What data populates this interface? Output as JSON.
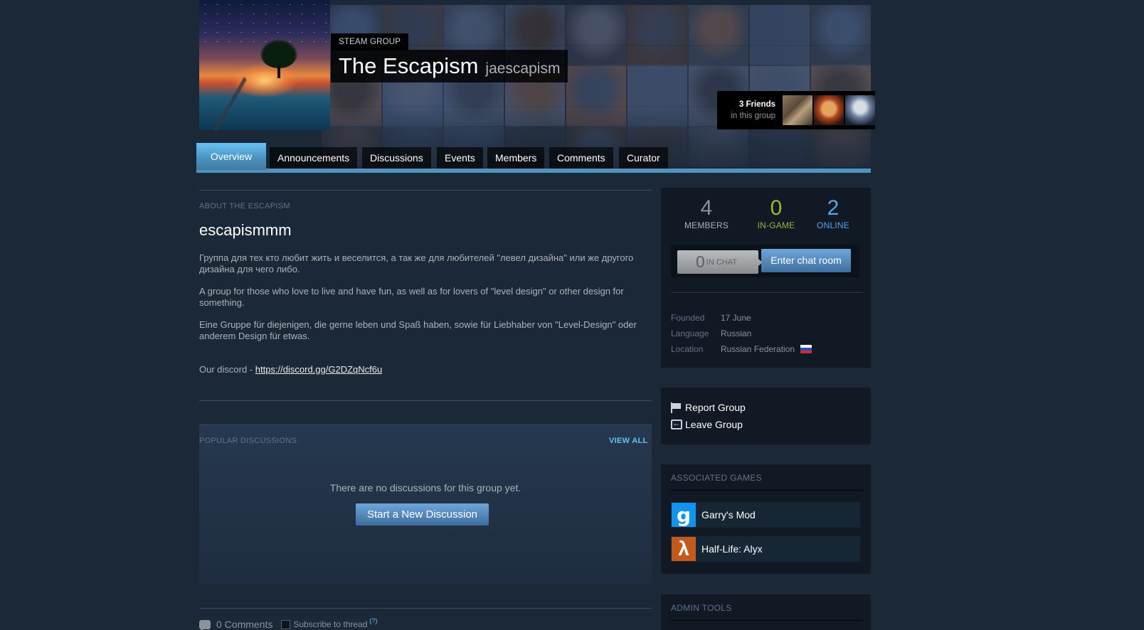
{
  "header": {
    "label": "STEAM GROUP",
    "name": "The Escapism",
    "abbreviation": "jaescapism",
    "friends_count": "3 Friends",
    "friends_sub": "in this group"
  },
  "tabs": [
    {
      "label": "Overview",
      "active": true
    },
    {
      "label": "Announcements"
    },
    {
      "label": "Discussions"
    },
    {
      "label": "Events"
    },
    {
      "label": "Members"
    },
    {
      "label": "Comments"
    },
    {
      "label": "Curator"
    }
  ],
  "about": {
    "label": "ABOUT THE ESCAPISM",
    "title": "escapismmm",
    "paragraphs": [
      "Группа для тех кто любит жить и веселится, а так же для любителей \"левел дизайна\" или же другого дизайна для чего либо.",
      "A group for those who love to live and have fun, as well as for lovers of \"level design\" or other design for something.",
      "Eine Gruppe für diejenigen, die gerne leben und Spaß haben, sowie für Liebhaber von \"Level-Design\" oder anderem Design für etwas."
    ],
    "discord_prefix": "Our discord - ",
    "discord_link": "https://discord.gg/G2DZqNcf6u"
  },
  "discussions": {
    "label": "POPULAR DISCUSSIONS",
    "view_all": "VIEW ALL",
    "empty": "There are no discussions for this group yet.",
    "start_button": "Start a New Discussion"
  },
  "comments": {
    "count": "0 Comments",
    "subscribe": "Subscribe to thread",
    "help": "(?)"
  },
  "stats": {
    "members": {
      "value": "4",
      "label": "MEMBERS",
      "color": "#8b929a"
    },
    "ingame": {
      "value": "0",
      "label": "IN-GAME",
      "color": "#90ba3c"
    },
    "online": {
      "value": "2",
      "label": "ONLINE",
      "color": "#57cbde"
    }
  },
  "chat": {
    "in_chat_count": "0",
    "in_chat_label": "IN CHAT",
    "enter_button": "Enter chat room"
  },
  "info": {
    "founded_label": "Founded",
    "founded_value": "17 June",
    "language_label": "Language",
    "language_value": "Russian",
    "location_label": "Location",
    "location_value": "Russian Federation"
  },
  "actions": {
    "report": "Report Group",
    "leave": "Leave Group"
  },
  "games": {
    "title": "ASSOCIATED GAMES",
    "items": [
      {
        "name": "Garry's Mod",
        "icon": "g",
        "icon_name": "garrys-mod-icon"
      },
      {
        "name": "Half-Life: Alyx",
        "icon": "λ",
        "icon_name": "half-life-alyx-icon"
      }
    ]
  },
  "admin": {
    "title": "ADMIN TOOLS"
  }
}
